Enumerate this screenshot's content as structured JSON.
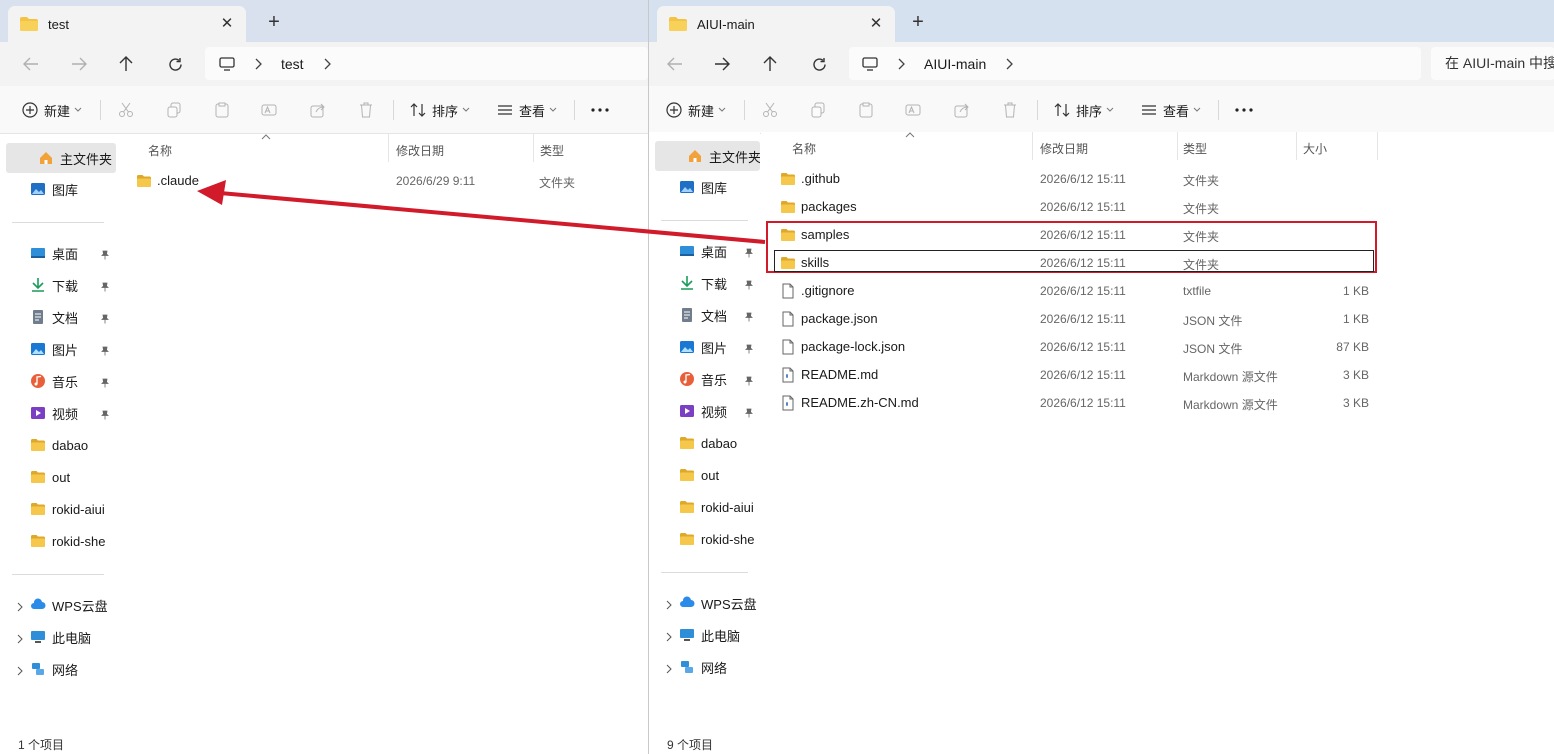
{
  "left": {
    "tab_title": "test",
    "address": "test",
    "toolbar": {
      "new_label": "新建",
      "sort_label": "排序",
      "view_label": "查看"
    },
    "sidebar": {
      "home": "主文件夹",
      "gallery": "图库",
      "pinned": [
        "桌面",
        "下载",
        "文档",
        "图片",
        "音乐",
        "视频"
      ],
      "folders": [
        "dabao",
        "out",
        "rokid-aiui",
        "rokid-she"
      ],
      "bottom": [
        "WPS云盘",
        "此电脑",
        "网络"
      ]
    },
    "columns": {
      "name": "名称",
      "modified": "修改日期",
      "type": "类型"
    },
    "files": [
      {
        "name": ".claude",
        "modified": "2026/6/29 9:11",
        "type": "文件夹",
        "kind": "folder"
      }
    ],
    "status": "1 个项目"
  },
  "right": {
    "tab_title": "AIUI-main",
    "address": "AIUI-main",
    "search_placeholder": "在 AIUI-main 中搜",
    "toolbar": {
      "new_label": "新建",
      "sort_label": "排序",
      "view_label": "查看"
    },
    "sidebar": {
      "home": "主文件夹",
      "gallery": "图库",
      "pinned": [
        "桌面",
        "下载",
        "文档",
        "图片",
        "音乐",
        "视频"
      ],
      "folders": [
        "dabao",
        "out",
        "rokid-aiui",
        "rokid-she"
      ],
      "bottom": [
        "WPS云盘",
        "此电脑",
        "网络"
      ]
    },
    "columns": {
      "name": "名称",
      "modified": "修改日期",
      "type": "类型",
      "size": "大小"
    },
    "files": [
      {
        "name": ".github",
        "modified": "2026/6/12 15:11",
        "type": "文件夹",
        "size": "",
        "kind": "folder"
      },
      {
        "name": "packages",
        "modified": "2026/6/12 15:11",
        "type": "文件夹",
        "size": "",
        "kind": "folder"
      },
      {
        "name": "samples",
        "modified": "2026/6/12 15:11",
        "type": "文件夹",
        "size": "",
        "kind": "folder"
      },
      {
        "name": "skills",
        "modified": "2026/6/12 15:11",
        "type": "文件夹",
        "size": "",
        "kind": "folder"
      },
      {
        "name": ".gitignore",
        "modified": "2026/6/12 15:11",
        "type": "txtfile",
        "size": "1 KB",
        "kind": "file"
      },
      {
        "name": "package.json",
        "modified": "2026/6/12 15:11",
        "type": "JSON 文件",
        "size": "1 KB",
        "kind": "file"
      },
      {
        "name": "package-lock.json",
        "modified": "2026/6/12 15:11",
        "type": "JSON 文件",
        "size": "87 KB",
        "kind": "file"
      },
      {
        "name": "README.md",
        "modified": "2026/6/12 15:11",
        "type": "Markdown 源文件",
        "size": "3 KB",
        "kind": "md"
      },
      {
        "name": "README.zh-CN.md",
        "modified": "2026/6/12 15:11",
        "type": "Markdown 源文件",
        "size": "3 KB",
        "kind": "md"
      }
    ],
    "status": "9 个项目"
  },
  "colors": {
    "annotation": "#d11a2a",
    "folder": "#f3c343",
    "folder_dark": "#e0a82a"
  }
}
